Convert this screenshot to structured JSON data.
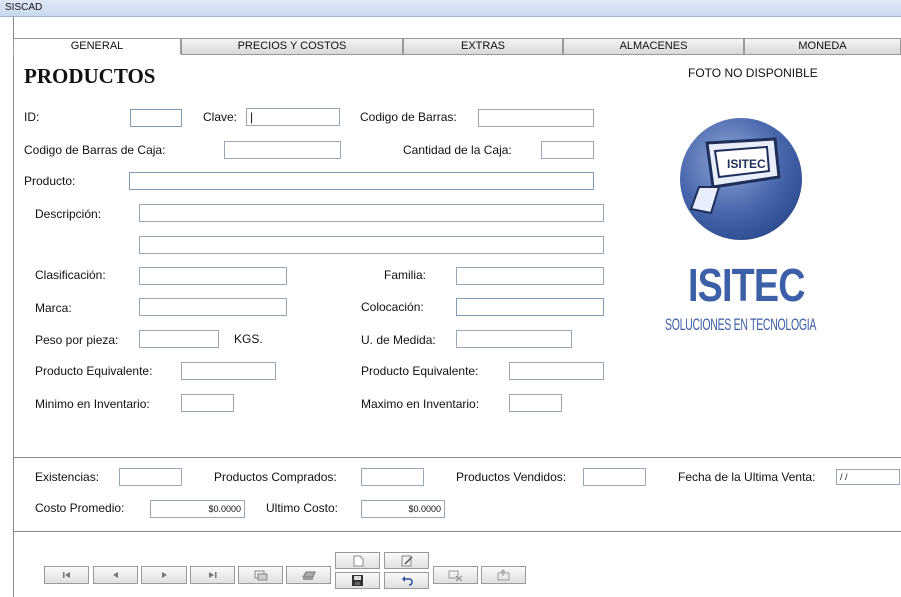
{
  "window": {
    "title": "SISCAD"
  },
  "tabs": [
    {
      "label": "GENERAL",
      "active": true
    },
    {
      "label": "PRECIOS Y COSTOS"
    },
    {
      "label": "EXTRAS"
    },
    {
      "label": "ALMACENES"
    },
    {
      "label": "MONEDA"
    }
  ],
  "form": {
    "heading": "PRODUCTOS",
    "photo_label": "FOTO NO DISPONIBLE",
    "id_label": "ID:",
    "clave_label": "Clave:",
    "clave_value": "|",
    "barcode_label": "Codigo de Barras:",
    "box_barcode_label": "Codigo de Barras de Caja:",
    "box_qty_label": "Cantidad de la Caja:",
    "product_label": "Producto:",
    "description_label": "Descripción:",
    "classification_label": "Clasificación:",
    "family_label": "Familia:",
    "brand_label": "Marca:",
    "placement_label": "Colocación:",
    "weight_label": "Peso por pieza:",
    "weight_unit": "KGS.",
    "measure_label": "U. de Medida:",
    "equiv1_label": "Producto Equivalente:",
    "equiv2_label": "Producto Equivalente:",
    "min_label": "Minimo en Inventario:",
    "max_label": "Maximo en Inventario:"
  },
  "stats": {
    "stock_label": "Existencias:",
    "bought_label": "Productos Comprados:",
    "sold_label": "Productos Vendidos:",
    "last_sale_label": "Fecha de la Ultima Venta:",
    "last_sale_value": "/ /",
    "avg_cost_label": "Costo Promedio:",
    "avg_cost_value": "$0.0000",
    "last_cost_label": "Ultimo Costo:",
    "last_cost_value": "$0.0000"
  },
  "logo": {
    "brand": "ISITEC",
    "tagline": "SOLUCIONES EN TECNOLOGIA",
    "badge": "ISITEC",
    "color": "#3d5fa8"
  },
  "toolbar": {
    "buttons": [
      "first-icon",
      "prev-icon",
      "next-icon",
      "last-icon",
      "search-icon",
      "print-icon",
      "new-icon",
      "edit-icon",
      "save-icon",
      "undo-icon",
      "delete-icon",
      "export-icon"
    ]
  }
}
